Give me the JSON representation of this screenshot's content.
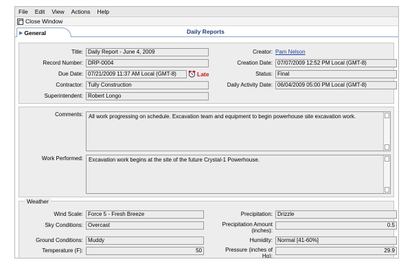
{
  "menu": [
    "File",
    "Edit",
    "View",
    "Actions",
    "Help"
  ],
  "toolbar": {
    "close_label": "Close Window"
  },
  "tabs": {
    "general": "General"
  },
  "page_title": "Daily Reports",
  "details": {
    "title_label": "Title:",
    "title_value": "Daily Report - June 4, 2009",
    "record_label": "Record Number:",
    "record_value": "DRP-0004",
    "due_label": "Due Date:",
    "due_value": "07/21/2009 11:37 AM Local (GMT-8)",
    "late_label": "Late",
    "contractor_label": "Contractor:",
    "contractor_value": "Tully Construction",
    "super_label": "Superintendent:",
    "super_value": "Robert Longo",
    "creator_label": "Creator:",
    "creator_value": "Pam Nelson",
    "creation_label": "Creation Date:",
    "creation_value": "07/07/2009 12:52 PM Local (GMT-8)",
    "status_label": "Status:",
    "status_value": "Final",
    "activity_label": "Daily Activity Date:",
    "activity_value": "06/04/2009 05:00 PM Local (GMT-8)"
  },
  "notes": {
    "comments_label": "Comments:",
    "comments_value": "All work progressing on schedule.  Excavation team and equipment to begin powerhouse site excavation work.",
    "work_label": "Work Performed:",
    "work_value": "Excavation work begins at the site of the future Crystal-1 Powerhouse."
  },
  "weather": {
    "legend": "Weather",
    "wind_label": "Wind Scale:",
    "wind_value": "Force 5 - Fresh Breeze",
    "sky_label": "Sky Conditions:",
    "sky_value": "Overcast",
    "ground_label": "Ground Conditions:",
    "ground_value": "Muddy",
    "temp_label": "Temperature (F):",
    "temp_value": "50",
    "precip_label": "Precipitation:",
    "precip_value": "Drizzle",
    "amount_label_1": "Precipitation Amount",
    "amount_label_2": "(inches):",
    "amount_value": "0.5",
    "humidity_label": "Humidity:",
    "humidity_value": "Normal [41-60%]",
    "pressure_label_1": "Pressure (inches of",
    "pressure_label_2": "Hg):",
    "pressure_value": "29.9"
  }
}
